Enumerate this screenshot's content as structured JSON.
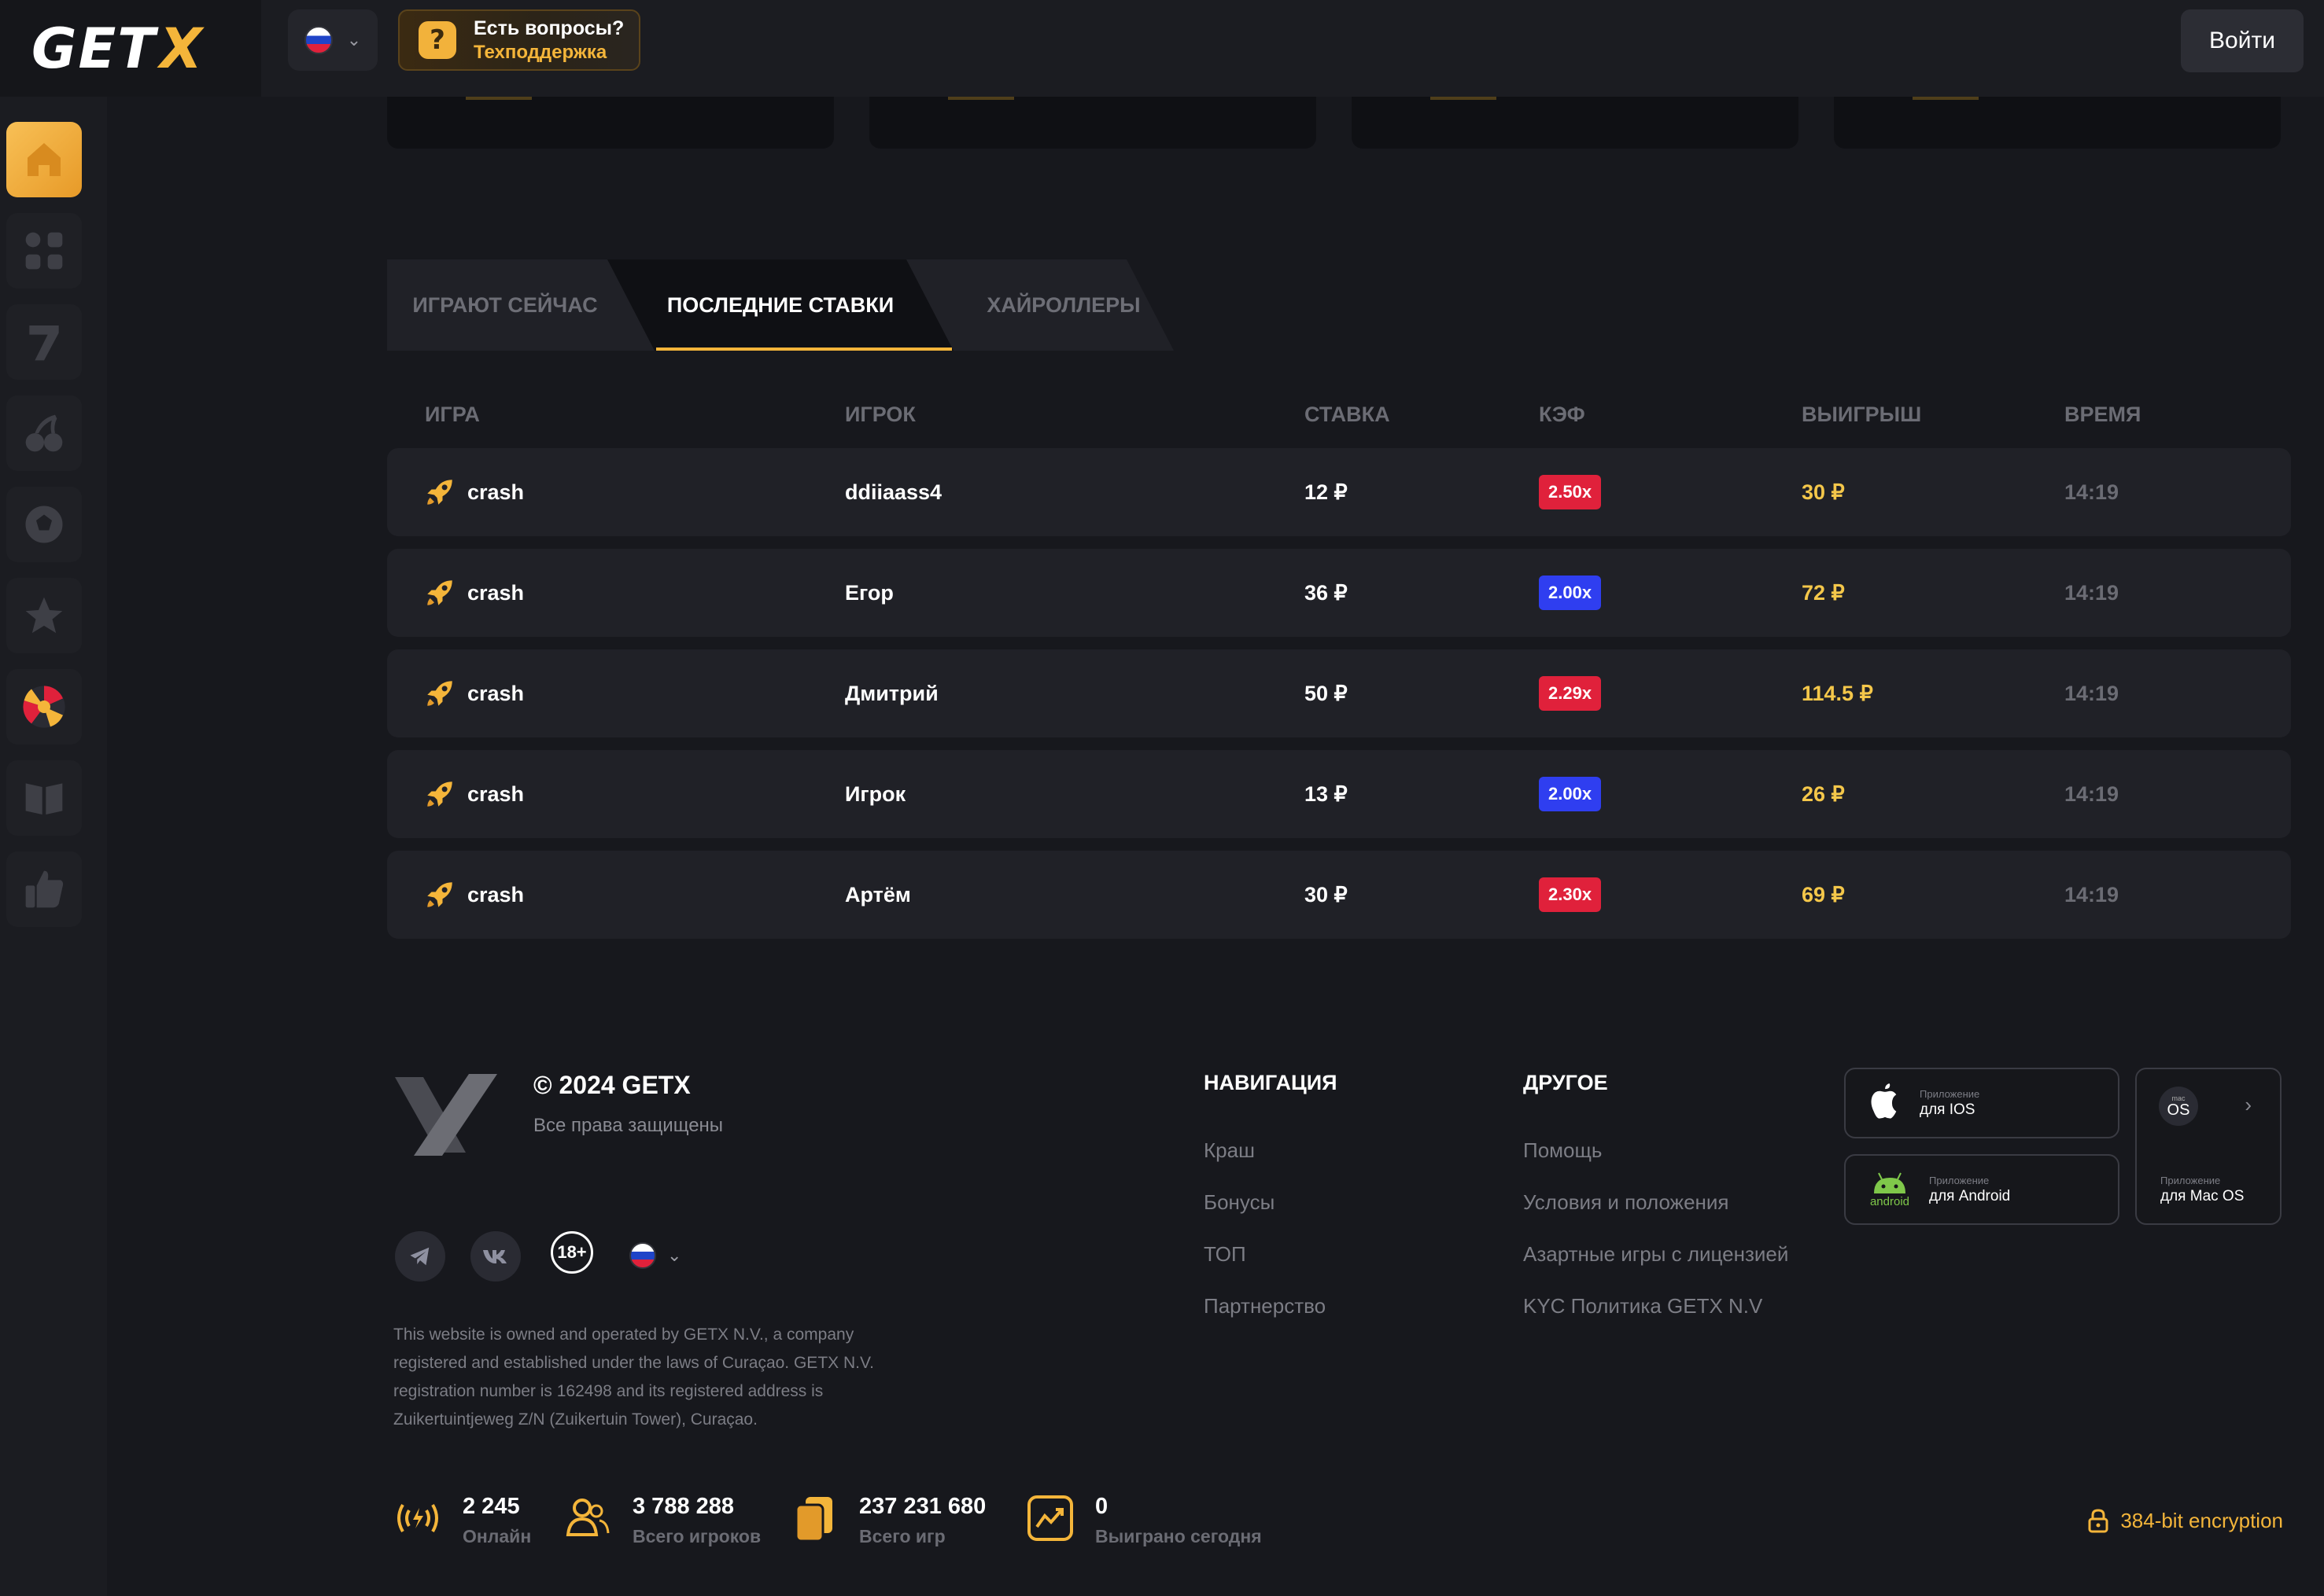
{
  "header": {
    "logo_main": "GET",
    "logo_x": "X",
    "support_title": "Есть вопросы?",
    "support_sub": "Техподдержка",
    "login_label": "Войти"
  },
  "tabs": [
    {
      "label": "ИГРАЮТ СЕЙЧАС"
    },
    {
      "label": "ПОСЛЕДНИЕ СТАВКИ"
    },
    {
      "label": "ХАЙРОЛЛЕРЫ"
    }
  ],
  "table": {
    "columns": [
      "ИГРА",
      "ИГРОК",
      "СТАВКА",
      "КЭФ",
      "ВЫИГРЫШ",
      "ВРЕМЯ"
    ],
    "rows": [
      {
        "game": "crash",
        "player": "ddiiaass4",
        "bet": "12 ₽",
        "coef": "2.50x",
        "coef_color": "#e0213b",
        "win": "30 ₽",
        "time": "14:19"
      },
      {
        "game": "crash",
        "player": "Егор",
        "bet": "36 ₽",
        "coef": "2.00x",
        "coef_color": "#2f3ef0",
        "win": "72 ₽",
        "time": "14:19"
      },
      {
        "game": "crash",
        "player": "Дмитрий",
        "bet": "50 ₽",
        "coef": "2.29x",
        "coef_color": "#e0213b",
        "win": "114.5 ₽",
        "time": "14:19"
      },
      {
        "game": "crash",
        "player": "Игрок",
        "bet": "13 ₽",
        "coef": "2.00x",
        "coef_color": "#2f3ef0",
        "win": "26 ₽",
        "time": "14:19"
      },
      {
        "game": "crash",
        "player": "Артём",
        "bet": "30 ₽",
        "coef": "2.30x",
        "coef_color": "#e0213b",
        "win": "69 ₽",
        "time": "14:19"
      }
    ]
  },
  "footer": {
    "copyright": "© 2024 GETX",
    "rights": "Все права защищены",
    "age": "18+",
    "legal": "This website is owned and operated by GETX N.V., a company registered and established under the laws of Curaçao. GETX N.V. registration number is 162498 and its registered address is Zuikertuintjeweg Z/N (Zuikertuin Tower), Curaçao.",
    "nav_title": "НАВИГАЦИЯ",
    "nav_links": [
      "Краш",
      "Бонусы",
      "ТОП",
      "Партнерство"
    ],
    "other_title": "ДРУГОЕ",
    "other_links": [
      "Помощь",
      "Условия и положения",
      "Азартные игры с лицензией",
      "KYC Политика GETX N.V"
    ],
    "apps": {
      "ios_small": "Приложение",
      "ios_big": "для IOS",
      "android_small": "Приложение",
      "android_big": "для Android",
      "android_word": "android",
      "mac_small": "Приложение",
      "mac_big": "для Mac OS",
      "mac_badge_small": "mac",
      "mac_badge": "OS"
    },
    "stats": [
      {
        "value": "2 245",
        "label": "Онлайн"
      },
      {
        "value": "3 788 288",
        "label": "Всего игроков"
      },
      {
        "value": "237 231 680",
        "label": "Всего игр"
      },
      {
        "value": "0",
        "label": "Выиграно сегодня"
      }
    ],
    "encryption": "384-bit encryption"
  },
  "colors": {
    "accent": "#f4b53a",
    "background": "#17181d",
    "row": "#202127"
  }
}
